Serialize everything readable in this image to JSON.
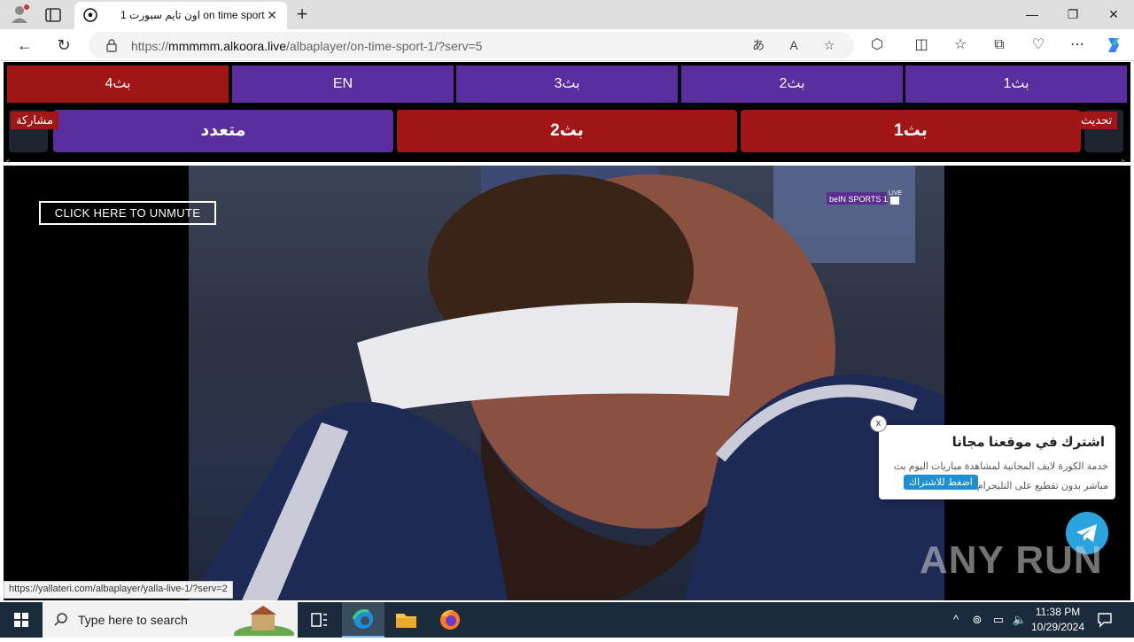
{
  "browser": {
    "tab_title": "اون تايم سبورت 1 on time sport",
    "url_prefix": "https://",
    "url_host": "mmmmm.alkoora.live",
    "url_path": "/albaplayer/on-time-sport-1/?serv=5",
    "status_url": "https://yallateri.com/albaplayer/yalla-live-1/?serv=2"
  },
  "servers": {
    "row1": [
      {
        "label": "بث4",
        "color": "red"
      },
      {
        "label": "EN",
        "color": "purple"
      },
      {
        "label": "بث3",
        "color": "purple"
      },
      {
        "label": "بث2",
        "color": "purple"
      },
      {
        "label": "بث1",
        "color": "purple"
      }
    ],
    "row2": [
      {
        "label": "متعدد",
        "color": "purple"
      },
      {
        "label": "بث2",
        "color": "red"
      },
      {
        "label": "بث1",
        "color": "red"
      }
    ],
    "share_label": "مشاركة",
    "refresh_label": "تحديث"
  },
  "player": {
    "unmute_label": "CLICK HERE TO UNMUTE",
    "channel_badge": "beIN SPORTS 1",
    "live_label": "LIVE"
  },
  "popup": {
    "title": "اشترك في موقعنا مجانا",
    "description": "خدمة الكورة لايف المجانية لمشاهدة مباريات اليوم بث مباشر بدون تقطيع على التليجرام",
    "cta": "اضغط للاشتراك",
    "close": "x"
  },
  "watermark": "ANY RUN",
  "taskbar": {
    "search_placeholder": "Type here to search",
    "time": "11:38 PM",
    "date": "10/29/2024"
  },
  "colors": {
    "purple": "#5b2ea0",
    "red": "#a11717",
    "telegram": "#2aa3de"
  }
}
